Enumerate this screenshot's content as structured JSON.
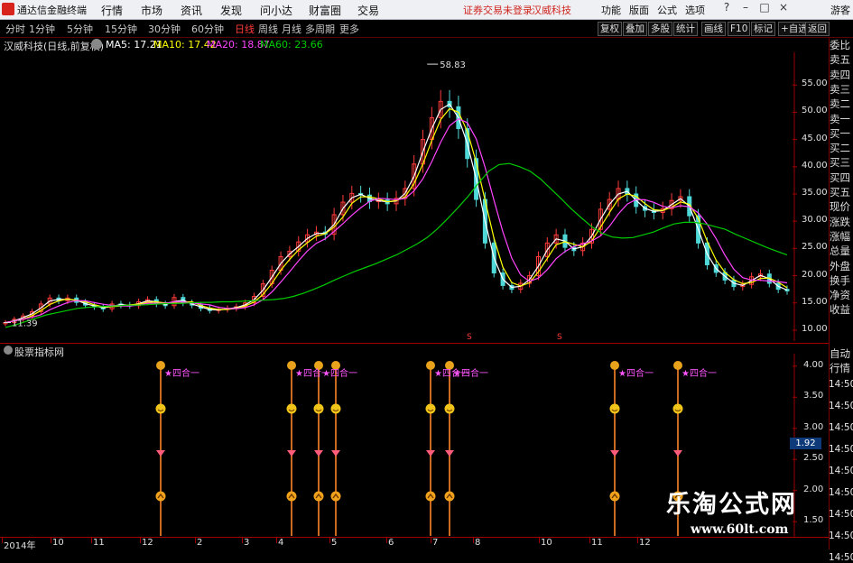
{
  "menu": {
    "app_title": "通达信金融终端",
    "items": [
      "行情",
      "市场",
      "资讯",
      "发现",
      "问小达",
      "财富圈",
      "交易"
    ],
    "warning": "证券交易未登录",
    "stock_link": "汉威科技",
    "right_items": [
      "功能",
      "版面",
      "公式",
      "选项"
    ],
    "guest": "游客"
  },
  "period_bar": {
    "items": [
      "分时",
      "1分钟",
      "5分钟",
      "15分钟",
      "30分钟",
      "60分钟",
      "日线",
      "周线",
      "月线",
      "多周期",
      "更多"
    ],
    "active": "日线",
    "buttons": [
      "复权",
      "叠加",
      "多股",
      "统计",
      "画线",
      "F10",
      "标记",
      "+自选",
      "返回"
    ]
  },
  "info": {
    "stock": "汉威科技(日线,前复权)",
    "ma5": "MA5: 17.21",
    "ma10": "MA10: 17.42",
    "ma20": "MA20: 18.87",
    "ma60": "MA60: 23.66"
  },
  "colors": {
    "up": "#ff3b3b",
    "down": "#4fd8d8",
    "ma5": "#ffffff",
    "ma10": "#ffff00",
    "ma20": "#ff44ff",
    "ma60": "#00cc00"
  },
  "chart_data": {
    "type": "candlestick",
    "y_ticks": [
      "55.00",
      "50.00",
      "45.00",
      "40.00",
      "35.00",
      "30.00",
      "25.00",
      "20.00",
      "15.00",
      "10.00"
    ],
    "ylim": [
      8,
      61
    ],
    "high_label": "58.83",
    "low_label": "11.39",
    "close_series": [
      11.4,
      12.0,
      12.6,
      13.4,
      14.8,
      15.9,
      15.4,
      15.9,
      15.1,
      14.6,
      14.3,
      13.9,
      14.8,
      14.6,
      14.5,
      15.2,
      15.6,
      14.8,
      14.5,
      16.0,
      15.0,
      14.6,
      14.0,
      13.6,
      13.8,
      14.0,
      14.3,
      15.0,
      16.2,
      18.5,
      21.0,
      23.5,
      24.5,
      26.2,
      27.5,
      28.0,
      27.6,
      31.2,
      33.5,
      35.1,
      34.8,
      33.6,
      33.9,
      33.2,
      34.2,
      36.0,
      40.5,
      45.0,
      49.0,
      52.0,
      51.0,
      47.0,
      41.5,
      34.0,
      26.0,
      20.5,
      18.2,
      17.5,
      18.6,
      20.0,
      23.5,
      26.0,
      27.5,
      25.2,
      24.6,
      26.0,
      28.5,
      32.2,
      34.0,
      36.0,
      35.0,
      32.7,
      32.0,
      31.6,
      32.3,
      33.8,
      34.5,
      31.0,
      26.0,
      22.0,
      20.6,
      19.2,
      18.0,
      18.4,
      19.8,
      20.3,
      18.6,
      17.5,
      17.2
    ],
    "ma60_series": [
      10.5,
      11.0,
      11.6,
      12.2,
      12.8,
      13.2,
      13.6,
      14.0,
      14.2,
      14.3,
      14.4,
      14.5,
      14.6,
      14.6,
      14.7,
      14.8,
      14.9,
      14.9,
      15.0,
      15.1,
      15.1,
      15.2,
      15.2,
      15.3,
      15.4,
      15.5,
      15.6,
      15.8,
      16.2,
      16.8,
      17.5,
      18.3,
      19.2,
      20.0,
      20.8,
      21.5,
      22.2,
      23.0,
      23.8,
      24.8,
      25.8,
      27.0,
      28.6,
      30.5,
      32.5,
      34.6,
      37.0,
      39.2,
      40.4,
      40.6,
      40.0,
      39.2,
      37.8,
      36.0,
      34.2,
      32.3,
      30.6,
      29.0,
      27.8,
      27.1,
      26.9,
      27.0,
      27.5,
      28.0,
      28.8,
      29.5,
      29.8,
      29.8,
      29.5,
      29.0,
      28.5,
      27.6,
      26.8,
      26.0,
      25.2,
      24.5,
      23.8
    ],
    "indicator_y_ticks": [
      "4.00",
      "3.50",
      "3.00",
      "2.50",
      "2.00",
      "1.50"
    ],
    "indicator_value": "1.92",
    "x_labels": [
      "2014年",
      "10",
      "11",
      "12",
      "2",
      "3",
      "4",
      "5",
      "6",
      "7",
      "8",
      "10",
      "11",
      "12"
    ]
  },
  "indicator_panel": {
    "title": "股票指标网",
    "signal_label": "★四合一"
  },
  "right_panel": [
    "委比",
    "卖五",
    "卖四",
    "卖三",
    "卖二",
    "卖一",
    "买一",
    "买二",
    "买三",
    "买四",
    "买五",
    "现价",
    "涨跌",
    "涨幅",
    "总量",
    "外盘",
    "换手",
    "净资",
    "收益"
  ],
  "right_panel_bottom": [
    "自动",
    "行情"
  ],
  "time_labels": [
    "14:50",
    "14:50",
    "14:50",
    "14:50",
    "14:50",
    "14:50",
    "14:50",
    "14:50",
    "14:50"
  ],
  "watermark": {
    "line1": "乐淘公式网",
    "line2": "www.60lt.com"
  }
}
